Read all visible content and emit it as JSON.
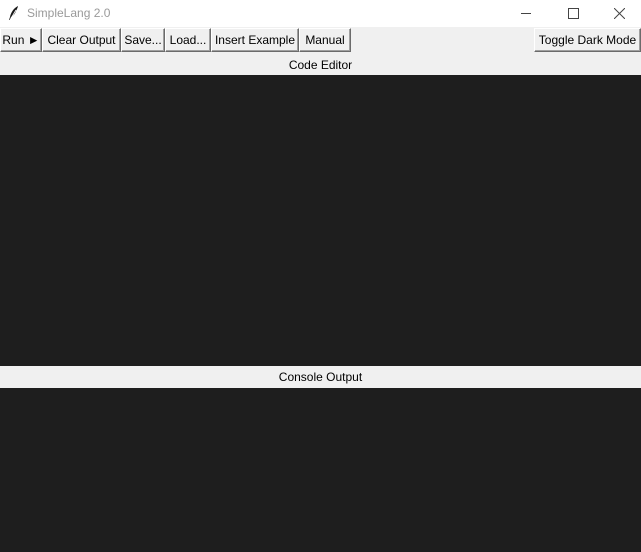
{
  "window": {
    "title": "SimpleLang 2.0",
    "icon": "feather-icon"
  },
  "titlebar_controls": [
    "minimize-icon",
    "maximize-icon",
    "close-icon"
  ],
  "toolbar": {
    "run_label": "Run ►",
    "clear_label": "Clear Output",
    "save_label": "Save...",
    "load_label": "Load...",
    "insert_example_label": "Insert Example",
    "manual_label": "Manual",
    "dark_mode_label": "Toggle Dark Mode"
  },
  "editor": {
    "label": "Code Editor",
    "content": ""
  },
  "console": {
    "label": "Console Output",
    "content": ""
  },
  "colors": {
    "panel_background": "#1e1e1e",
    "window_background": "#f0f0f0",
    "titlebar_background": "#ffffff"
  }
}
